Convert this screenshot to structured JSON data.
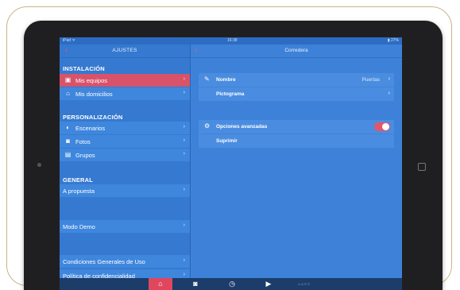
{
  "status_bar": {
    "left": "iPad ᯤ",
    "time": "16:38",
    "right": "▮ 27%"
  },
  "left_panel": {
    "title": "AJUSTES",
    "sections": [
      {
        "header": "INSTALACIÓN",
        "items": [
          {
            "label": "Mis equipos",
            "icon": "devices-icon",
            "selected": true
          },
          {
            "label": "Mis domicilios",
            "icon": "home-icon",
            "selected": false
          }
        ]
      },
      {
        "header": "PERSONALIZACIÓN",
        "items": [
          {
            "label": "Escenarios",
            "icon": "scenario-icon"
          },
          {
            "label": "Fotos",
            "icon": "camera-icon"
          },
          {
            "label": "Grupos",
            "icon": "groups-icon"
          }
        ]
      },
      {
        "header": "GENERAL",
        "items": [
          {
            "label": "A propuesta"
          }
        ]
      }
    ],
    "demo_mode": "Modo Demo",
    "terms": "Condiciones Generales de Uso",
    "privacy": "Política de confidencialidad"
  },
  "right_panel": {
    "title": "Corredera",
    "group1": {
      "name_label": "Nombre",
      "name_value": "Puertas",
      "pictogram_label": "Pictograma"
    },
    "group2": {
      "advanced_label": "Opciones avanzadas",
      "advanced_enabled": true,
      "delete_label": "Suprimir"
    }
  },
  "tab_bar": {
    "tabs": [
      {
        "icon": "home-icon",
        "active": true
      },
      {
        "icon": "camera-icon",
        "active": false
      },
      {
        "icon": "clock-icon",
        "active": false
      },
      {
        "icon": "play-icon",
        "active": false
      }
    ],
    "small_text": "AJUSTE"
  },
  "colors": {
    "accent": "#d8536a",
    "panel_blue": "#3579d0",
    "toggle_on": "#e2566a"
  }
}
